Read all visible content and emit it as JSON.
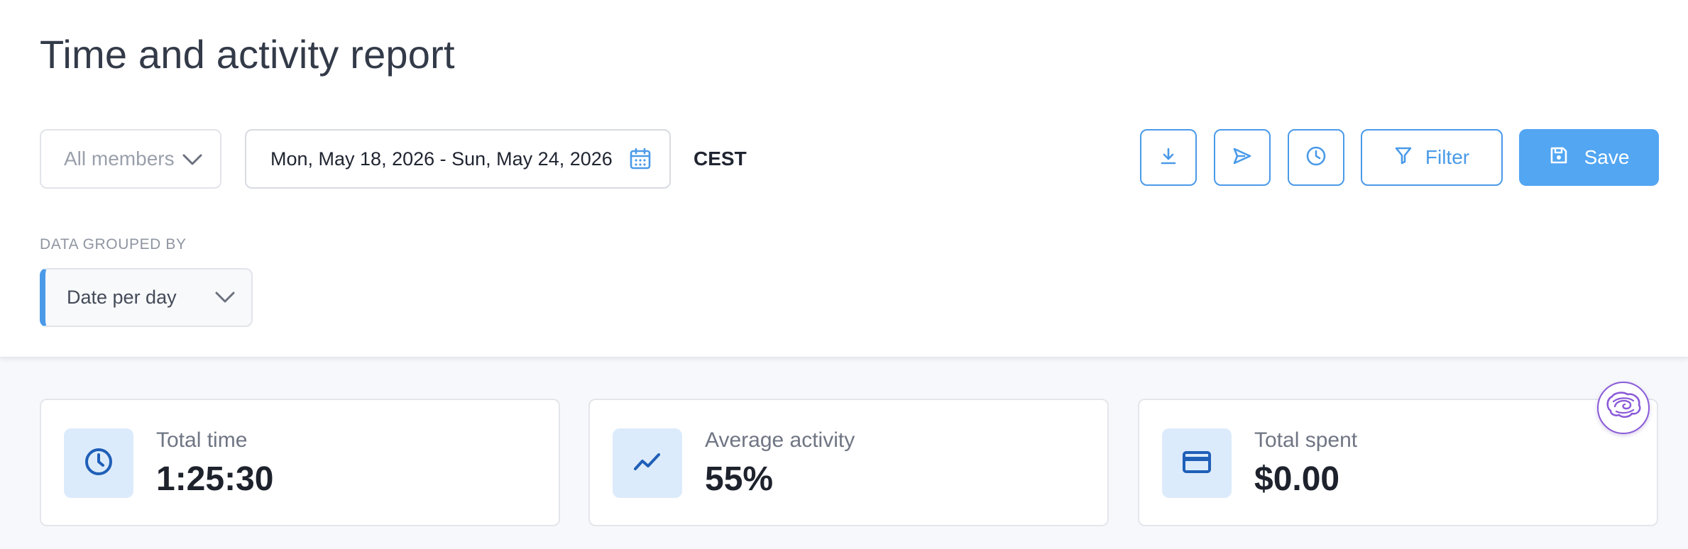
{
  "header": {
    "title": "Time and activity report"
  },
  "toolbar": {
    "members_select": "All members",
    "date_range": "Mon, May 18, 2026 - Sun, May 24, 2026",
    "timezone": "CEST",
    "filter_label": "Filter",
    "save_label": "Save",
    "icons": [
      "download-icon",
      "send-icon",
      "clock-icon",
      "filter-icon",
      "save-icon"
    ]
  },
  "grouping": {
    "label": "DATA GROUPED BY",
    "value": "Date per day"
  },
  "stats": [
    {
      "label": "Total time",
      "value": "1:25:30",
      "icon": "clock-icon"
    },
    {
      "label": "Average activity",
      "value": "55%",
      "icon": "trend-icon"
    },
    {
      "label": "Total spent",
      "value": "$0.00",
      "icon": "credit-card-icon"
    }
  ],
  "colors": {
    "accent": "#4a9ae8",
    "save_button": "#52a6f2",
    "stat_icon_bg": "#dcebfb",
    "stat_icon": "#1f5fb8",
    "brain_badge": "#8a5ad8"
  }
}
